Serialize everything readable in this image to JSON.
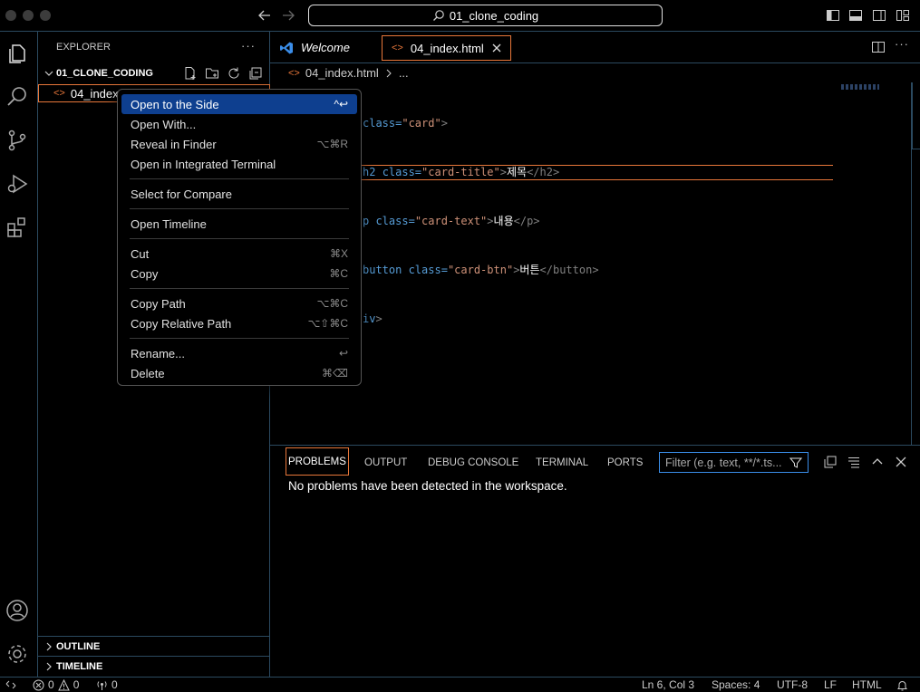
{
  "titlebar": {
    "search_text": "01_clone_coding"
  },
  "explorer": {
    "header": "EXPLORER",
    "more": "···",
    "folder": "01_CLONE_CODING",
    "file": "04_index.html",
    "file_visible": "04_index",
    "outline": "OUTLINE",
    "timeline": "TIMELINE"
  },
  "tabs": [
    {
      "label": "Welcome",
      "active": false
    },
    {
      "label": "04_index.html",
      "active": true
    }
  ],
  "breadcrumb": {
    "file": "04_index.html",
    "rest": "..."
  },
  "code": {
    "line1": {
      "attr": "class=",
      "val": "\"card\"",
      "end": ">"
    },
    "line2": {
      "tag": "h2 ",
      "attr": "class=",
      "val": "\"card-title\"",
      "gt": ">",
      "text": "제목",
      "close": "</h2>"
    },
    "line3": {
      "tag": "p ",
      "attr": "class=",
      "val": "\"card-text\"",
      "gt": ">",
      "text": "내용",
      "close": "</p>"
    },
    "line4": {
      "tag": "button ",
      "attr": "class=",
      "val": "\"card-btn\"",
      "gt": ">",
      "text": "버튼",
      "close": "</button>"
    },
    "line5": {
      "tag": "iv",
      "end": ">"
    }
  },
  "panel": {
    "tabs": [
      "PROBLEMS",
      "OUTPUT",
      "DEBUG CONSOLE",
      "TERMINAL",
      "PORTS"
    ],
    "filter_placeholder": "Filter (e.g. text, **/*.ts...",
    "message": "No problems have been detected in the workspace."
  },
  "context_menu": {
    "items": [
      {
        "label": "Open to the Side",
        "shortcut": "^↩",
        "selected": true
      },
      {
        "label": "Open With...",
        "shortcut": ""
      },
      {
        "label": "Reveal in Finder",
        "shortcut": "⌥⌘R"
      },
      {
        "label": "Open in Integrated Terminal",
        "shortcut": ""
      },
      {
        "label": "Select for Compare",
        "shortcut": ""
      },
      {
        "label": "Open Timeline",
        "shortcut": ""
      },
      {
        "label": "Cut",
        "shortcut": "⌘X"
      },
      {
        "label": "Copy",
        "shortcut": "⌘C"
      },
      {
        "label": "Copy Path",
        "shortcut": "⌥⌘C"
      },
      {
        "label": "Copy Relative Path",
        "shortcut": "⌥⇧⌘C"
      },
      {
        "label": "Rename...",
        "shortcut": "↩"
      },
      {
        "label": "Delete",
        "shortcut": "⌘⌫"
      }
    ]
  },
  "statusbar": {
    "errors": "0",
    "warnings": "0",
    "ports": "0",
    "position": "Ln 6, Col 3",
    "spaces": "Spaces: 4",
    "encoding": "UTF-8",
    "eol": "LF",
    "language": "HTML"
  },
  "colors": {
    "accent_orange": "#e8773a",
    "selection_blue": "#0e3f8f",
    "border_blue": "#2b4a60",
    "vscode_blue": "#3b8eea"
  }
}
